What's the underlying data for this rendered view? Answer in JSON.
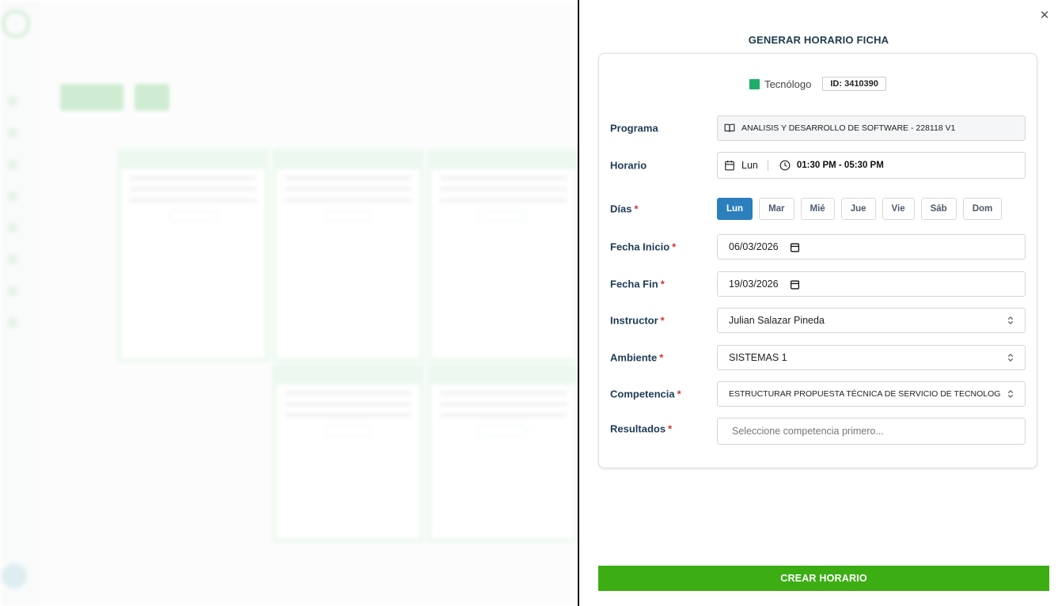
{
  "colors": {
    "accent_blue": "#2b7fbd",
    "create_green": "#3dad14",
    "tecnologo_green": "#1fae6a",
    "title_navy": "#1e3a4c",
    "required_red": "#d33333"
  },
  "drawer": {
    "title": "GENERAR HORARIO FICHA",
    "close_icon": "close-icon",
    "type_label": "Tecnólogo",
    "id_badge": "ID: 3410390",
    "fields": {
      "programa": {
        "label": "Programa",
        "value": "ANALISIS Y DESARROLLO DE SOFTWARE - 228118 V1",
        "icon": "book-icon"
      },
      "horario": {
        "label": "Horario",
        "day": "Lun",
        "time": "01:30 PM - 05:30 PM",
        "icons": [
          "calendar-icon",
          "clock-icon"
        ]
      },
      "dias": {
        "label": "Días",
        "required": "*",
        "options": [
          "Lun",
          "Mar",
          "Mié",
          "Jue",
          "Vie",
          "Sáb",
          "Dom"
        ],
        "selected": "Lun"
      },
      "fecha_inicio": {
        "label": "Fecha Inicio",
        "required": "*",
        "value": "06/03/2026"
      },
      "fecha_fin": {
        "label": "Fecha Fin",
        "required": "*",
        "value": "19/03/2026"
      },
      "instructor": {
        "label": "Instructor",
        "required": "*",
        "value": "Julian Salazar Pineda"
      },
      "ambiente": {
        "label": "Ambiente",
        "required": "*",
        "value": "SISTEMAS 1"
      },
      "competencia": {
        "label": "Competencia",
        "required": "*",
        "value": "ESTRUCTURAR PROPUESTA TÉCNICA DE SERVICIO DE TECNOLOGÍA DE"
      },
      "resultados": {
        "label": "Resultados",
        "required": "*",
        "placeholder": "Seleccione competencia primero..."
      }
    },
    "submit_label": "CREAR HORARIO"
  }
}
